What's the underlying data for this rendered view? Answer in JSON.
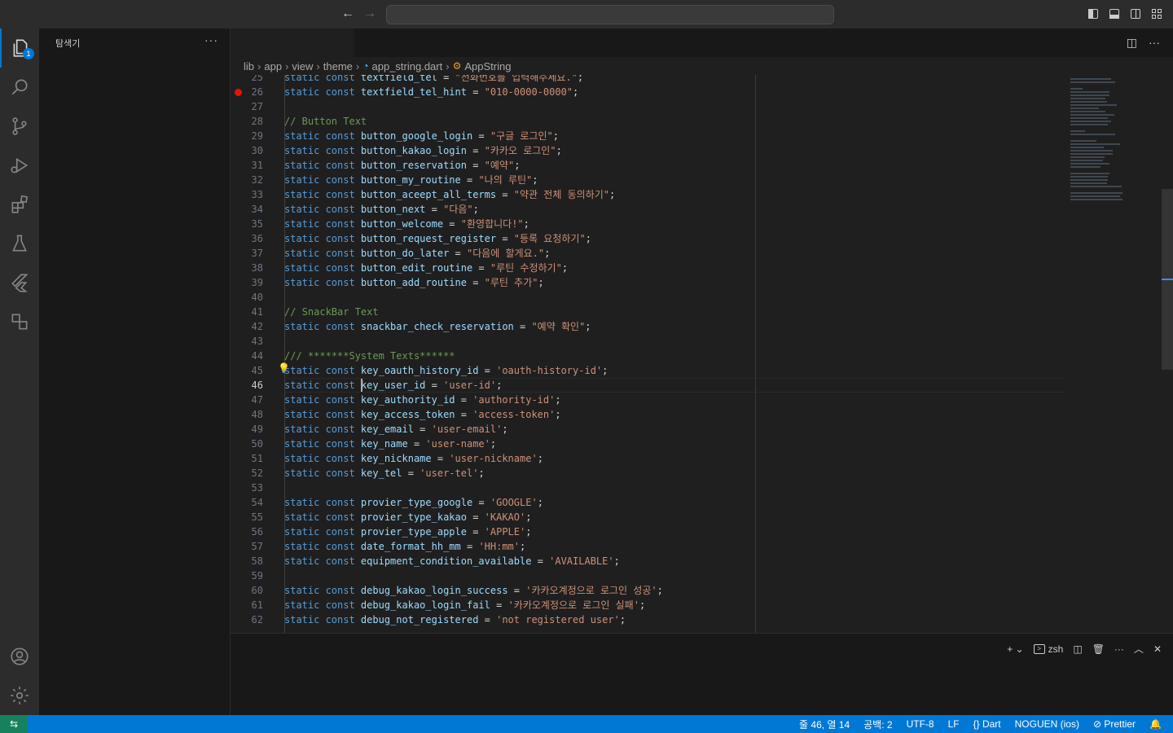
{
  "sidebar": {
    "title": "탐색기",
    "more": "···"
  },
  "activity": {
    "explorer_badge": "1"
  },
  "breadcrumbs": [
    "lib",
    "app",
    "view",
    "theme",
    "app_string.dart",
    "AppString"
  ],
  "editor": {
    "current_line": 46,
    "lines": [
      {
        "n": 25,
        "code": [
          [
            "kw",
            "static const "
          ],
          [
            "id",
            "textfield_tel"
          ],
          [
            "op",
            " = "
          ],
          [
            "str",
            "\"전화번호를 입력해주세요.\""
          ],
          [
            "op",
            ";"
          ]
        ]
      },
      {
        "n": 26,
        "code": [
          [
            "kw",
            "static const "
          ],
          [
            "id",
            "textfield_tel_hint"
          ],
          [
            "op",
            " = "
          ],
          [
            "str",
            "\"010-0000-0000\""
          ],
          [
            "op",
            ";"
          ]
        ]
      },
      {
        "n": 27,
        "code": []
      },
      {
        "n": 28,
        "code": [
          [
            "cmt",
            "// Button Text"
          ]
        ]
      },
      {
        "n": 29,
        "code": [
          [
            "kw",
            "static const "
          ],
          [
            "id",
            "button_google_login"
          ],
          [
            "op",
            " = "
          ],
          [
            "str",
            "\"구글 로그인\""
          ],
          [
            "op",
            ";"
          ]
        ]
      },
      {
        "n": 30,
        "code": [
          [
            "kw",
            "static const "
          ],
          [
            "id",
            "button_kakao_login"
          ],
          [
            "op",
            " = "
          ],
          [
            "str",
            "\"카카오 로그인\""
          ],
          [
            "op",
            ";"
          ]
        ]
      },
      {
        "n": 31,
        "code": [
          [
            "kw",
            "static const "
          ],
          [
            "id",
            "button_reservation"
          ],
          [
            "op",
            " = "
          ],
          [
            "str",
            "\"예약\""
          ],
          [
            "op",
            ";"
          ]
        ]
      },
      {
        "n": 32,
        "code": [
          [
            "kw",
            "static const "
          ],
          [
            "id",
            "button_my_routine"
          ],
          [
            "op",
            " = "
          ],
          [
            "str",
            "\"나의 루틴\""
          ],
          [
            "op",
            ";"
          ]
        ]
      },
      {
        "n": 33,
        "code": [
          [
            "kw",
            "static const "
          ],
          [
            "id",
            "button_aceept_all_terms"
          ],
          [
            "op",
            " = "
          ],
          [
            "str",
            "\"약관 전체 동의하기\""
          ],
          [
            "op",
            ";"
          ]
        ]
      },
      {
        "n": 34,
        "code": [
          [
            "kw",
            "static const "
          ],
          [
            "id",
            "button_next"
          ],
          [
            "op",
            " = "
          ],
          [
            "str",
            "\"다음\""
          ],
          [
            "op",
            ";"
          ]
        ]
      },
      {
        "n": 35,
        "code": [
          [
            "kw",
            "static const "
          ],
          [
            "id",
            "button_welcome"
          ],
          [
            "op",
            " = "
          ],
          [
            "str",
            "\"환영합니다!\""
          ],
          [
            "op",
            ";"
          ]
        ]
      },
      {
        "n": 36,
        "code": [
          [
            "kw",
            "static const "
          ],
          [
            "id",
            "button_request_register"
          ],
          [
            "op",
            " = "
          ],
          [
            "str",
            "\"등록 요청하기\""
          ],
          [
            "op",
            ";"
          ]
        ]
      },
      {
        "n": 37,
        "code": [
          [
            "kw",
            "static const "
          ],
          [
            "id",
            "button_do_later"
          ],
          [
            "op",
            " = "
          ],
          [
            "str",
            "\"다음에 할게요.\""
          ],
          [
            "op",
            ";"
          ]
        ]
      },
      {
        "n": 38,
        "code": [
          [
            "kw",
            "static const "
          ],
          [
            "id",
            "button_edit_routine"
          ],
          [
            "op",
            " = "
          ],
          [
            "str",
            "\"루틴 수정하기\""
          ],
          [
            "op",
            ";"
          ]
        ]
      },
      {
        "n": 39,
        "code": [
          [
            "kw",
            "static const "
          ],
          [
            "id",
            "button_add_routine"
          ],
          [
            "op",
            " = "
          ],
          [
            "str",
            "\"루틴 추가\""
          ],
          [
            "op",
            ";"
          ]
        ]
      },
      {
        "n": 40,
        "code": []
      },
      {
        "n": 41,
        "code": [
          [
            "cmt",
            "// SnackBar Text"
          ]
        ]
      },
      {
        "n": 42,
        "code": [
          [
            "kw",
            "static const "
          ],
          [
            "id",
            "snackbar_check_reservation"
          ],
          [
            "op",
            " = "
          ],
          [
            "str",
            "\"예약 확인\""
          ],
          [
            "op",
            ";"
          ]
        ]
      },
      {
        "n": 43,
        "code": []
      },
      {
        "n": 44,
        "code": [
          [
            "cmt",
            "/// *******System Texts******"
          ]
        ]
      },
      {
        "n": 45,
        "code": [
          [
            "kw",
            "static const "
          ],
          [
            "id",
            "key_oauth_history_id"
          ],
          [
            "op",
            " = "
          ],
          [
            "str",
            "'oauth-history-id'"
          ],
          [
            "op",
            ";"
          ]
        ]
      },
      {
        "n": 46,
        "code": [
          [
            "kw",
            "static const "
          ],
          [
            "id",
            "key_user_id"
          ],
          [
            "op",
            " = "
          ],
          [
            "str",
            "'user-id'"
          ],
          [
            "op",
            ";"
          ]
        ]
      },
      {
        "n": 47,
        "code": [
          [
            "kw",
            "static const "
          ],
          [
            "id",
            "key_authority_id"
          ],
          [
            "op",
            " = "
          ],
          [
            "str",
            "'authority-id'"
          ],
          [
            "op",
            ";"
          ]
        ]
      },
      {
        "n": 48,
        "code": [
          [
            "kw",
            "static const "
          ],
          [
            "id",
            "key_access_token"
          ],
          [
            "op",
            " = "
          ],
          [
            "str",
            "'access-token'"
          ],
          [
            "op",
            ";"
          ]
        ]
      },
      {
        "n": 49,
        "code": [
          [
            "kw",
            "static const "
          ],
          [
            "id",
            "key_email"
          ],
          [
            "op",
            " = "
          ],
          [
            "str",
            "'user-email'"
          ],
          [
            "op",
            ";"
          ]
        ]
      },
      {
        "n": 50,
        "code": [
          [
            "kw",
            "static const "
          ],
          [
            "id",
            "key_name"
          ],
          [
            "op",
            " = "
          ],
          [
            "str",
            "'user-name'"
          ],
          [
            "op",
            ";"
          ]
        ]
      },
      {
        "n": 51,
        "code": [
          [
            "kw",
            "static const "
          ],
          [
            "id",
            "key_nickname"
          ],
          [
            "op",
            " = "
          ],
          [
            "str",
            "'user-nickname'"
          ],
          [
            "op",
            ";"
          ]
        ]
      },
      {
        "n": 52,
        "code": [
          [
            "kw",
            "static const "
          ],
          [
            "id",
            "key_tel"
          ],
          [
            "op",
            " = "
          ],
          [
            "str",
            "'user-tel'"
          ],
          [
            "op",
            ";"
          ]
        ]
      },
      {
        "n": 53,
        "code": []
      },
      {
        "n": 54,
        "code": [
          [
            "kw",
            "static const "
          ],
          [
            "id",
            "provier_type_google"
          ],
          [
            "op",
            " = "
          ],
          [
            "str",
            "'GOOGLE'"
          ],
          [
            "op",
            ";"
          ]
        ]
      },
      {
        "n": 55,
        "code": [
          [
            "kw",
            "static const "
          ],
          [
            "id",
            "provier_type_kakao"
          ],
          [
            "op",
            " = "
          ],
          [
            "str",
            "'KAKAO'"
          ],
          [
            "op",
            ";"
          ]
        ]
      },
      {
        "n": 56,
        "code": [
          [
            "kw",
            "static const "
          ],
          [
            "id",
            "provier_type_apple"
          ],
          [
            "op",
            " = "
          ],
          [
            "str",
            "'APPLE'"
          ],
          [
            "op",
            ";"
          ]
        ]
      },
      {
        "n": 57,
        "code": [
          [
            "kw",
            "static const "
          ],
          [
            "id",
            "date_format_hh_mm"
          ],
          [
            "op",
            " = "
          ],
          [
            "str",
            "'HH:mm'"
          ],
          [
            "op",
            ";"
          ]
        ]
      },
      {
        "n": 58,
        "code": [
          [
            "kw",
            "static const "
          ],
          [
            "id",
            "equipment_condition_available"
          ],
          [
            "op",
            " = "
          ],
          [
            "str",
            "'AVAILABLE'"
          ],
          [
            "op",
            ";"
          ]
        ]
      },
      {
        "n": 59,
        "code": []
      },
      {
        "n": 60,
        "code": [
          [
            "kw",
            "static const "
          ],
          [
            "id",
            "debug_kakao_login_success"
          ],
          [
            "op",
            " = "
          ],
          [
            "str",
            "'카카오계정으로 로그인 성공'"
          ],
          [
            "op",
            ";"
          ]
        ]
      },
      {
        "n": 61,
        "code": [
          [
            "kw",
            "static const "
          ],
          [
            "id",
            "debug_kakao_login_fail"
          ],
          [
            "op",
            " = "
          ],
          [
            "str",
            "'카카오계정으로 로그인 실패'"
          ],
          [
            "op",
            ";"
          ]
        ]
      },
      {
        "n": 62,
        "code": [
          [
            "kw",
            "static const "
          ],
          [
            "id",
            "debug_not_registered"
          ],
          [
            "op",
            " = "
          ],
          [
            "str",
            "'not registered user'"
          ],
          [
            "op",
            ";"
          ]
        ]
      }
    ]
  },
  "panel": {
    "terminal_name": "zsh"
  },
  "statusbar": {
    "position": "줄 46, 열 14",
    "spaces": "공백: 2",
    "encoding": "UTF-8",
    "eol": "LF",
    "language": "{} Dart",
    "device": "NOGUEN (ios)",
    "prettier": "⊘ Prettier"
  },
  "colors": {
    "accent": "#0078d4",
    "remote": "#16825d",
    "keyword": "#569cd6",
    "string": "#ce9178",
    "comment": "#6a9955",
    "identifier": "#9cdcfe"
  }
}
